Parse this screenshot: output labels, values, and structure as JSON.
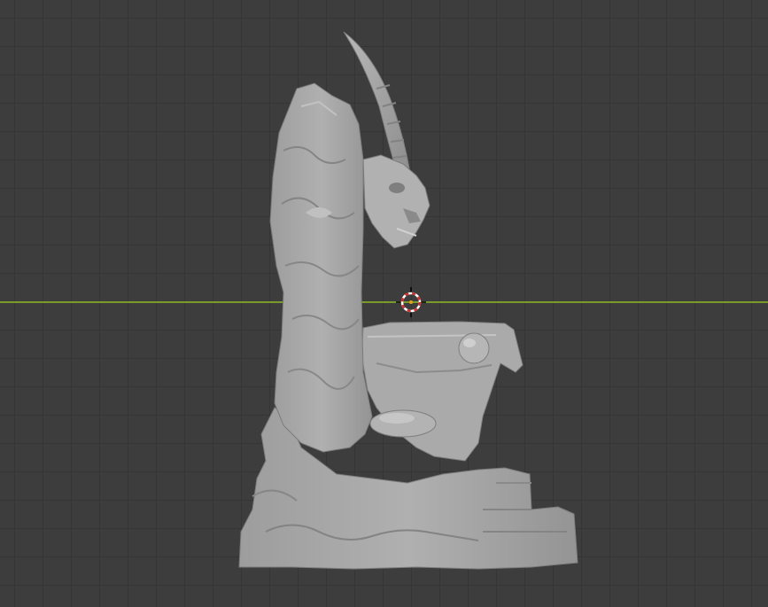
{
  "viewport": {
    "background": "#3d3d3d",
    "grid_color": "#353535",
    "x_axis_color": "#7a9a2a",
    "model_color": "#a9a9a9",
    "model_shadow": "#6f6f6f",
    "model_highlight": "#c9c9c9",
    "cursor_ring_red": "#d42a2a",
    "cursor_ring_white": "#ffffff",
    "cursor_center": "#e3a11c"
  },
  "scene": {
    "object": "sculpted-throne-with-horned-skull",
    "tool": "3d-cursor"
  }
}
